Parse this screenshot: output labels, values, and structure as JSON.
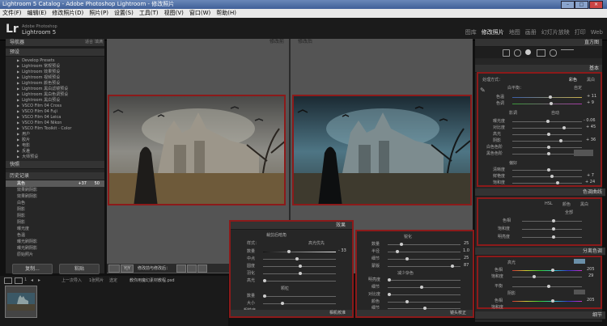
{
  "window": {
    "title": "Lightroom 5 Catalog - Adobe Photoshop Lightroom - 修改照片"
  },
  "menu": [
    "文件(F)",
    "编辑(E)",
    "修改照片(D)",
    "照片(P)",
    "设置(S)",
    "工具(T)",
    "视图(V)",
    "窗口(W)",
    "帮助(H)"
  ],
  "brand": {
    "sub": "Adobe Photoshop",
    "name": "Lightroom 5"
  },
  "modules": [
    "图库",
    "修改照片",
    "地图",
    "画册",
    "幻灯片放映",
    "打印",
    "Web"
  ],
  "left": {
    "navigator": "导航器",
    "nav_opts": [
      "适合",
      "填满"
    ],
    "presets_title": "预设",
    "presets": [
      "Develop Presets",
      "Lightroom 常规预设",
      "Lightroom 效果预设",
      "Lightroom 视频预设",
      "Lightroom 颜色预设",
      "Lightroom 黑白滤镜预设",
      "Lightroom 黑白色调预设",
      "Lightroom 黑白预设",
      "VSCO Film 04 Cross",
      "VSCO Film 04 Fuji",
      "VSCO Film 04 Leica",
      "VSCO Film 04 Nikon",
      "VSCO Film Toolkit - Color",
      "用户",
      "胶片",
      "电影",
      "反差",
      "大师预设"
    ],
    "snapshots": "快照",
    "history_title": "历史记录",
    "history": [
      {
        "label": "黑色",
        "v1": "+37",
        "v2": "50"
      },
      {
        "label": "效果刷阴影",
        "v1": "",
        "v2": ""
      },
      {
        "label": "效果刷阴影",
        "v1": "",
        "v2": ""
      },
      {
        "label": "白色",
        "v1": "",
        "v2": ""
      },
      {
        "label": "阴影",
        "v1": "",
        "v2": ""
      },
      {
        "label": "阴影",
        "v1": "",
        "v2": ""
      },
      {
        "label": "阴影",
        "v1": "",
        "v2": ""
      },
      {
        "label": "曝光度",
        "v1": "",
        "v2": ""
      },
      {
        "label": "色温",
        "v1": "",
        "v2": ""
      },
      {
        "label": "曝光刷阴影",
        "v1": "",
        "v2": ""
      },
      {
        "label": "曝光刷阴影",
        "v1": "",
        "v2": ""
      },
      {
        "label": "原始照片",
        "v1": "",
        "v2": ""
      }
    ],
    "copy_btn": "复制...",
    "paste_btn": "粘贴"
  },
  "center": {
    "before": "修改前",
    "after": "修改后",
    "toolbar_label": "修改前与修改后："
  },
  "right": {
    "histogram": "直方图",
    "basic_title": "基本",
    "treatment": "处理方式：",
    "treatment_color": "彩色",
    "treatment_bw": "黑白",
    "wb": "白平衡：",
    "wb_value": "自定",
    "temp": "色温",
    "temp_value": "+ 11",
    "tint": "色调",
    "tint_value": "+ 9",
    "tone": "影调",
    "tone_auto": "自动",
    "exposure": "曝光度",
    "exposure_value": "- 0.06",
    "contrast": "对比度",
    "contrast_value": "+ 45",
    "highlights": "高光",
    "shadows": "阴影",
    "shadows_value": "+ 36",
    "whites": "白色色阶",
    "blacks": "黑色色阶",
    "presence": "偏好",
    "clarity": "清晰度",
    "vibrance": "鲜艳度",
    "vibrance_value": "+ 7",
    "saturation": "饱和度",
    "saturation_value": "+ 24",
    "tone_curve": "色调曲线",
    "hsl_tabs": [
      "HSL",
      "颜色",
      "黑白"
    ],
    "hsl_all": "全部",
    "hue": "色相",
    "saturation2": "饱和度",
    "luminance": "明亮度",
    "split_title": "分离色调",
    "highlights2": "高光",
    "hue2": "色相",
    "hue2_value": "205",
    "sat2": "饱和度",
    "sat2_value": "29",
    "balance": "平衡",
    "shadows2": "阴影",
    "hue3": "色相",
    "hue3_value": "205",
    "sat3": "饱和度",
    "detail": "细节"
  },
  "popup1": {
    "title": "效果",
    "vig_title": "裁剪后暗角",
    "style": "样式：",
    "style_value": "高光优先",
    "amount": "数量",
    "amount_value": "- 33",
    "midpoint": "中点",
    "roundness": "圆度",
    "feather": "羽化",
    "highlights": "高光",
    "grain_title": "颗粒",
    "grain_amount": "数量",
    "grain_size": "大小",
    "grain_rough": "粗糙度",
    "footer": "相机校准"
  },
  "popup2": {
    "sharpen_title": "锐化",
    "s_amount": "数量",
    "s_amount_value": "25",
    "s_radius": "半径",
    "s_radius_value": "1.0",
    "s_detail": "细节",
    "s_detail_value": "25",
    "s_mask": "蒙版",
    "s_mask_value": "87",
    "noise_title": "减少杂色",
    "n_lum": "明亮度",
    "n_detail": "细节",
    "n_contrast": "对比度",
    "n_color": "颜色",
    "n_cdetail": "细节",
    "footer": "镜头校正"
  },
  "filmstrip": {
    "prev": "上一次导入",
    "count": "1张照片",
    "sel": "选定",
    "file": "教你用魔幻素材教程.psd",
    "view": "1"
  }
}
